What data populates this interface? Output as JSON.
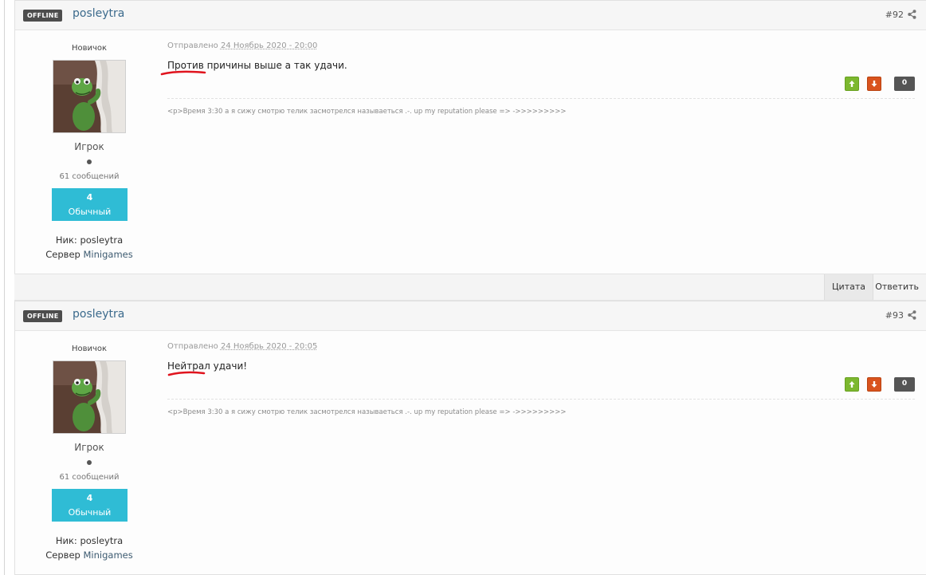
{
  "posts": [
    {
      "status": "OFFLINE",
      "author": "posleytra",
      "number": "#92",
      "rank": "Новичок",
      "group": "Игрок",
      "post_count": "61 сообщений",
      "rep_level": "4",
      "rep_title": "Обычный",
      "nick": "Ник: posleytra",
      "server_label": "Сервер ",
      "server_value": "Minigames",
      "posted_label": "Отправлено ",
      "posted_date": "24 Ноябрь 2020 - 20:00",
      "message": "Против причины выше а так удачи.",
      "rep_count": "0",
      "signature": "<p>Время 3:30 а я сижу смотрю телик засмотрелся называеться .-. up my reputation please => ->>>>>>>>>"
    },
    {
      "status": "OFFLINE",
      "author": "posleytra",
      "number": "#93",
      "rank": "Новичок",
      "group": "Игрок",
      "post_count": "61 сообщений",
      "rep_level": "4",
      "rep_title": "Обычный",
      "nick": "Ник: posleytra",
      "server_label": "Сервер ",
      "server_value": "Minigames",
      "posted_label": "Отправлено ",
      "posted_date": "24 Ноябрь 2020 - 20:05",
      "message": "Нейтрал удачи!",
      "rep_count": "0",
      "signature": "<p>Время 3:30 а я сижу смотрю телик засмотрелся называеться .-. up my reputation please => ->>>>>>>>>"
    }
  ],
  "post_actions": {
    "quote_label": "Цитата",
    "reply_label": "Ответить"
  },
  "colors": {
    "accent_link": "#3b6a8c",
    "rep_box": "#2fbcd5",
    "vote_up": "#7cb82f",
    "vote_down": "#d9531e",
    "annotation": "#e0141e"
  },
  "icons": [
    "share-icon",
    "arrow-up-icon",
    "arrow-down-icon"
  ]
}
